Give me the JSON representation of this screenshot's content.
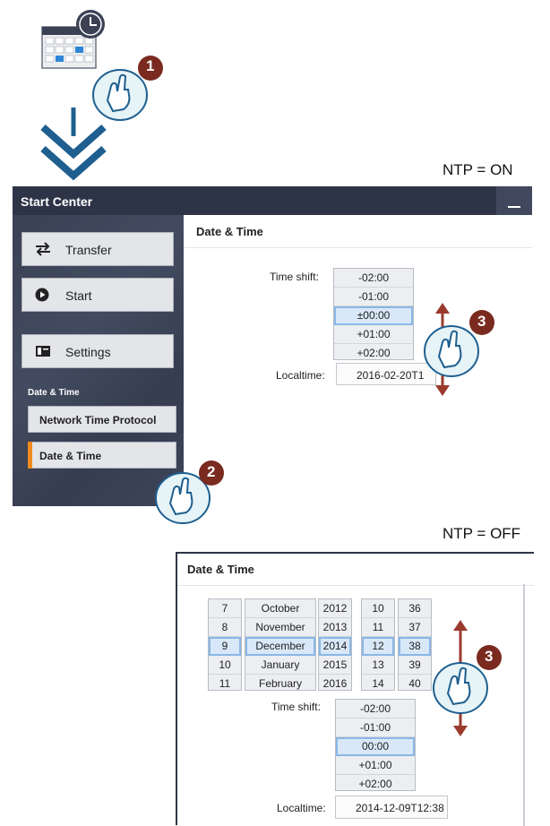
{
  "ntp_on_label": "NTP = ON",
  "ntp_off_label": "NTP = OFF",
  "steps": [
    "1",
    "2",
    "3",
    "3"
  ],
  "panel": {
    "title": "Start Center",
    "buttons": [
      {
        "label": "Transfer",
        "icon": "transfer-icon"
      },
      {
        "label": "Start",
        "icon": "play-icon"
      },
      {
        "label": "Settings",
        "icon": "settings-icon"
      }
    ],
    "section_label": "Date & Time",
    "sub_buttons": [
      {
        "label": "Network Time Protocol"
      },
      {
        "label": "Date & Time"
      }
    ],
    "main": {
      "title": "Date & Time",
      "time_shift_label": "Time shift:",
      "time_shift_options": [
        "-02:00",
        "-01:00",
        "±00:00",
        "+01:00",
        "+02:00"
      ],
      "time_shift_selected": "±00:00",
      "localtime_label": "Localtime:",
      "localtime_value": "2016-02-20T1"
    }
  },
  "bottom": {
    "title": "Date & Time",
    "day_options": [
      "7",
      "8",
      "9",
      "10",
      "11"
    ],
    "month_options": [
      "October",
      "November",
      "December",
      "January",
      "February"
    ],
    "year_options": [
      "2012",
      "2013",
      "2014",
      "2015",
      "2016"
    ],
    "hour_options": [
      "10",
      "11",
      "12",
      "13",
      "14"
    ],
    "minute_options": [
      "36",
      "37",
      "38",
      "39",
      "40"
    ],
    "selected_row": 2,
    "time_shift_label": "Time shift:",
    "time_shift_options": [
      "-02:00",
      "-01:00",
      "00:00",
      "+01:00",
      "+02:00"
    ],
    "localtime_label": "Localtime:",
    "localtime_value": "2014-12-09T12:38"
  },
  "colors": {
    "header_bg": "#2e3447",
    "sidebar_bg": "#3a4155",
    "accent_orange": "#f28b1e",
    "step_badge": "#7a2a1f",
    "arrow_red": "#9a3a2c",
    "arrow_blue": "#1e5f8f",
    "selection": "#d9e8f8"
  }
}
